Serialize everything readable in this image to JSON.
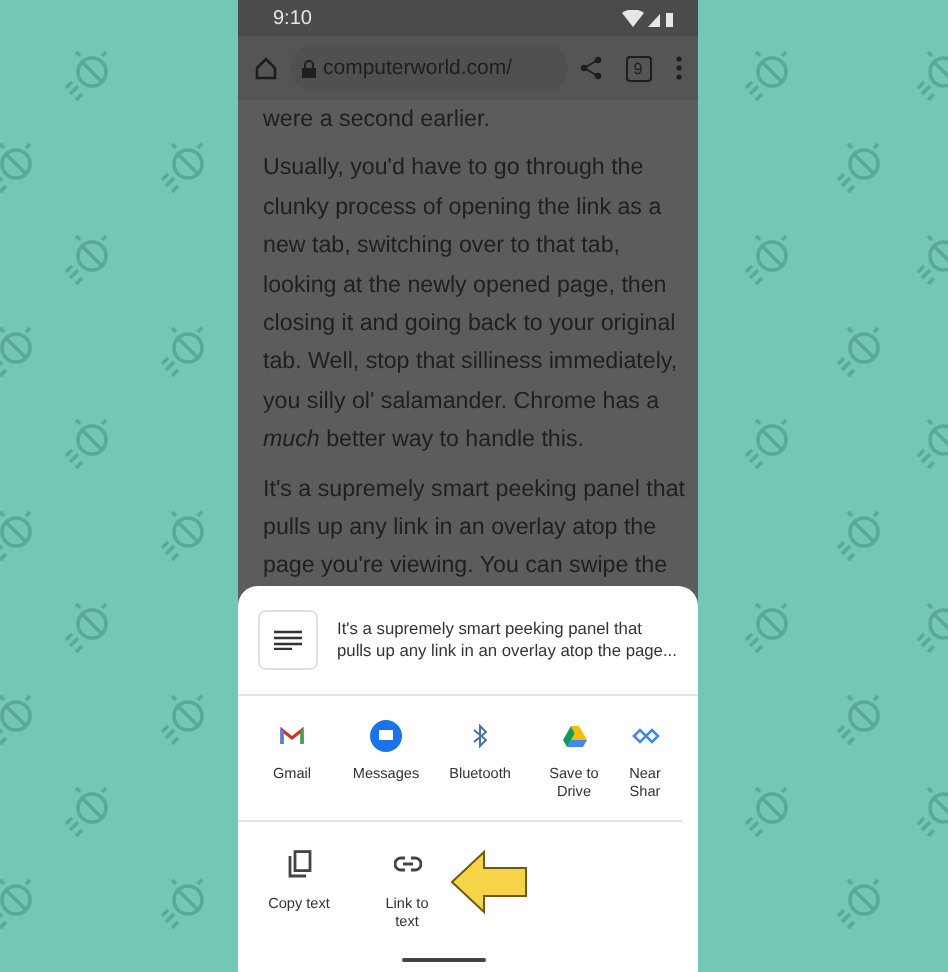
{
  "status_bar": {
    "time": "9:10"
  },
  "toolbar": {
    "url": "computerworld.com/",
    "tab_count": "9"
  },
  "article": {
    "paragraphs": [
      "were a second earlier.",
      "Usually, you'd have to go through the clunky process of opening the link as a new tab, switching over to that tab, looking at the newly opened page, then closing it and going back to your original tab. Well, stop that silliness immediately, you silly ol' salamander. Chrome has a *much* better way to handle this.",
      "It's a supremely smart peeking panel that pulls up any link in an overlay atop the page you're viewing. You can swipe the"
    ]
  },
  "share_sheet": {
    "preview_text": "It's a supremely smart peeking panel that pulls up any link in an overlay atop the page...",
    "targets": [
      {
        "kind": "gmail",
        "label": "Gmail"
      },
      {
        "kind": "messages",
        "label": "Messages"
      },
      {
        "kind": "bluetooth",
        "label": "Bluetooth"
      },
      {
        "kind": "drive",
        "label": "Save to Drive"
      },
      {
        "kind": "nearby",
        "label": "Near Shar"
      }
    ],
    "actions": [
      {
        "kind": "copy",
        "label": "Copy text"
      },
      {
        "kind": "link",
        "label": "Link to text"
      }
    ]
  }
}
